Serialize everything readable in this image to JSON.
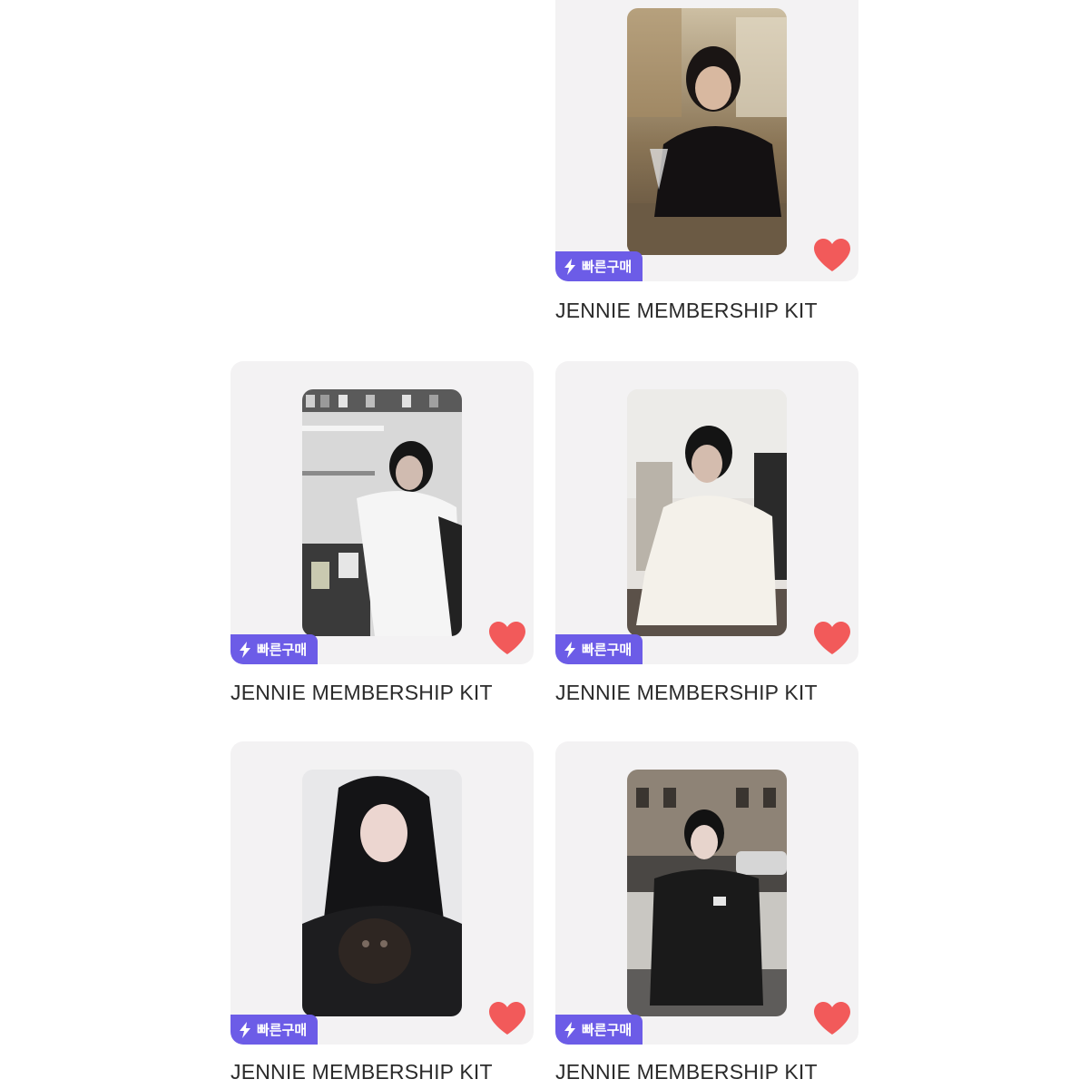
{
  "colors": {
    "card_background": "#f3f2f3",
    "badge_background": "#6c5ce7",
    "heart": "#f25a5a",
    "title_text": "#2a2a2a"
  },
  "products": [
    {
      "title": "JENNIE MEMBERSHIP KIT",
      "badge": "빠른구매",
      "photo_description": "woman seated at marble cafe table with wine glass, warm ornate interior",
      "liked": true
    },
    {
      "title": "JENNIE MEMBERSHIP KIT",
      "badge": "빠른구매",
      "photo_description": "woman in white sweater posing in kitchen with shelves of jars",
      "liked": true
    },
    {
      "title": "JENNIE MEMBERSHIP KIT",
      "badge": "빠른구매",
      "photo_description": "woman in white turtleneck leaning on table indoors",
      "liked": true
    },
    {
      "title": "JENNIE MEMBERSHIP KIT",
      "badge": "빠른구매",
      "photo_description": "woman with long dark hair holding a small dark dog",
      "liked": true
    },
    {
      "title": "JENNIE MEMBERSHIP KIT",
      "badge": "빠른구매",
      "photo_description": "woman in black jacket standing on a city street with cars and buildings",
      "liked": true
    }
  ]
}
